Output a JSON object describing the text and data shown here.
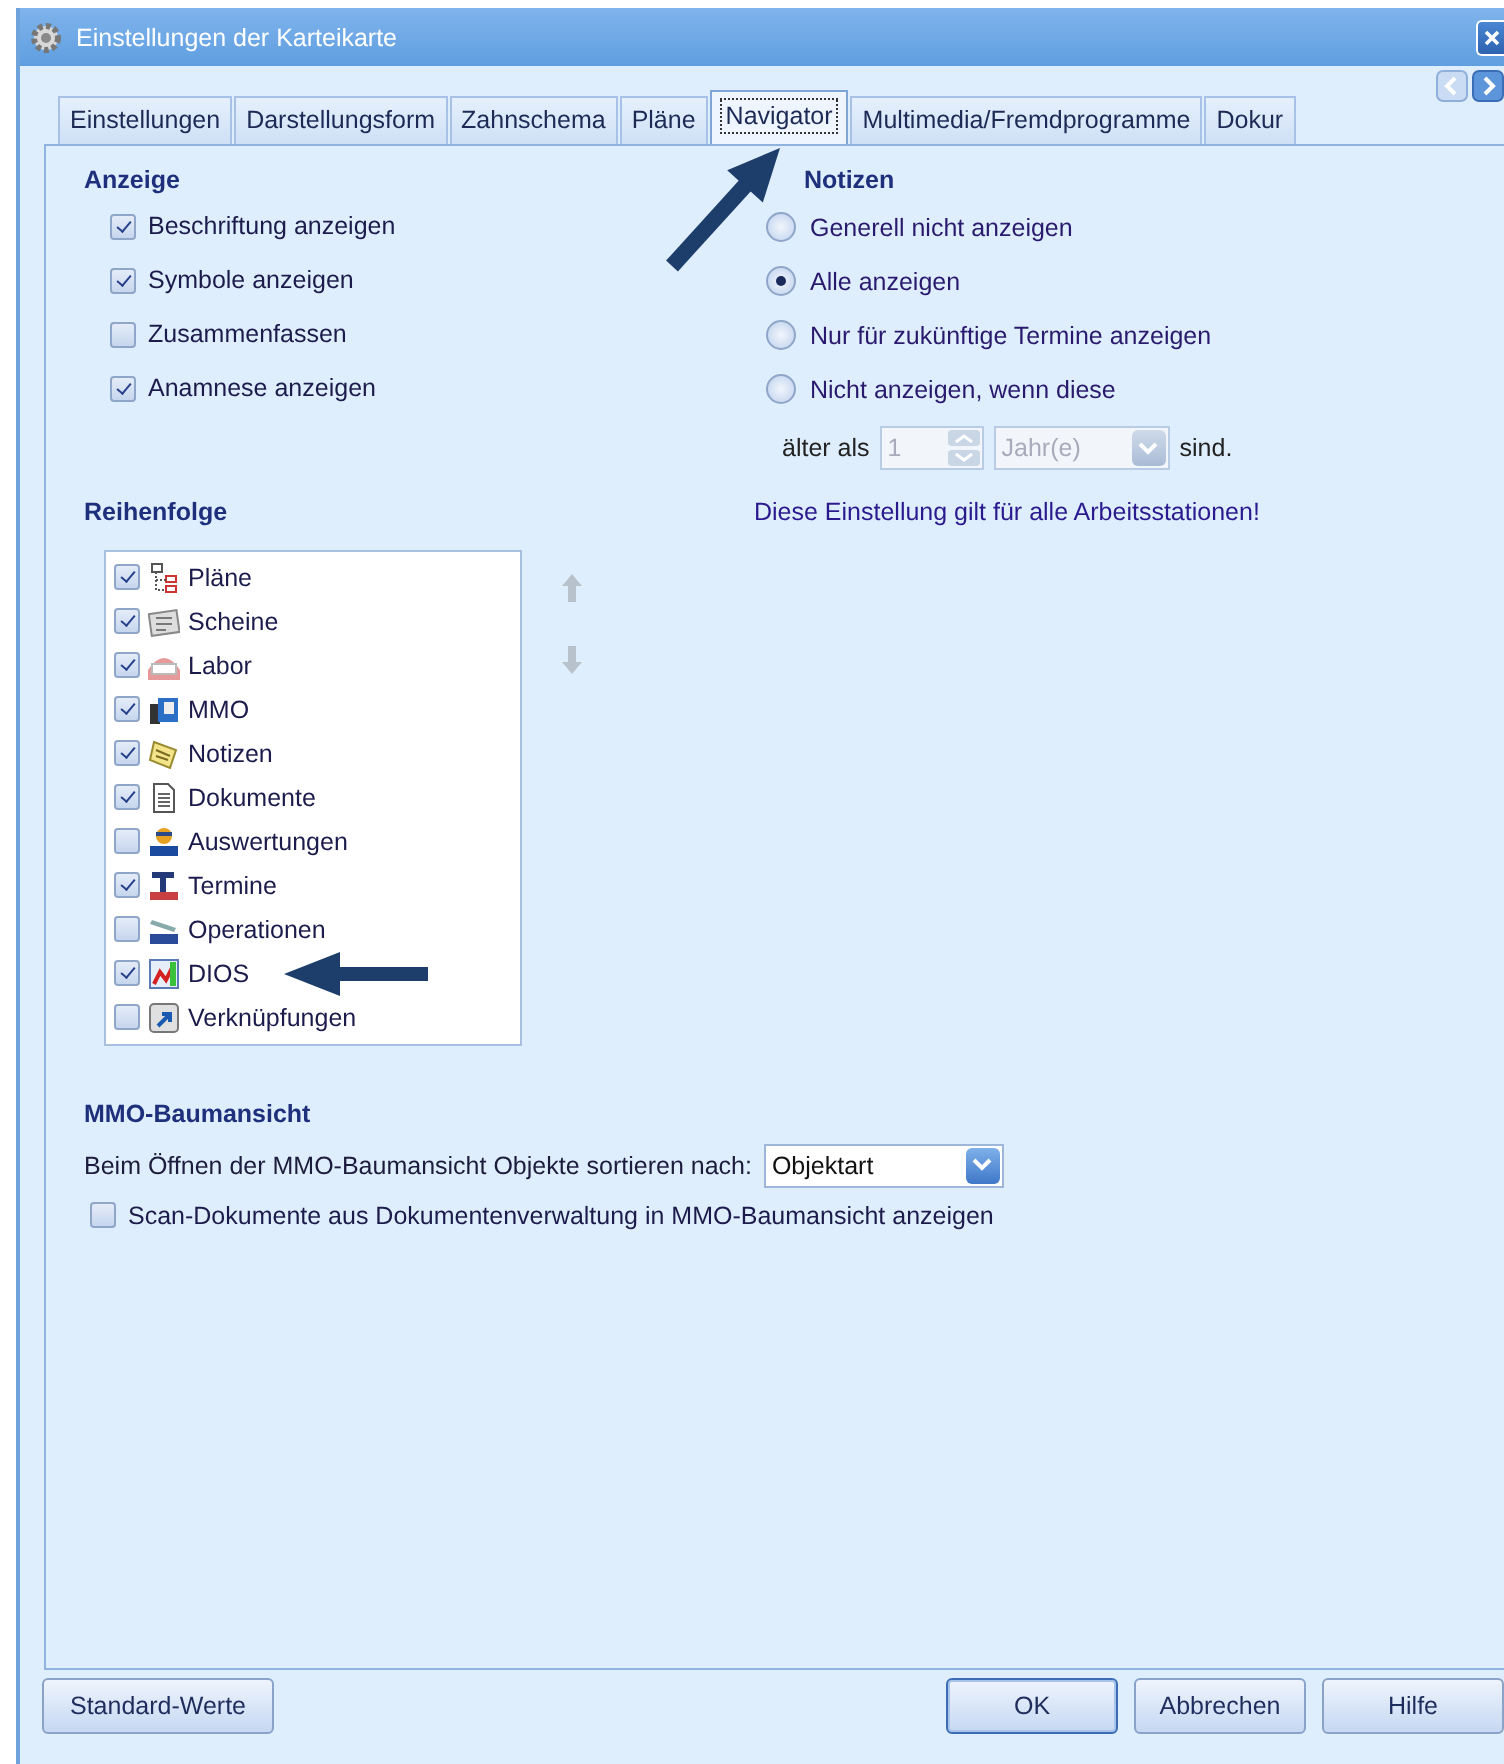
{
  "window": {
    "title": "Einstellungen der Karteikarte"
  },
  "tabs": [
    {
      "label": "Einstellungen",
      "selected": false
    },
    {
      "label": "Darstellungsform",
      "selected": false
    },
    {
      "label": "Zahnschema",
      "selected": false
    },
    {
      "label": "Pläne",
      "selected": false
    },
    {
      "label": "Navigator",
      "selected": true
    },
    {
      "label": "Multimedia/Fremdprogramme",
      "selected": false
    },
    {
      "label": "Dokur",
      "selected": false
    }
  ],
  "anzeige": {
    "heading": "Anzeige",
    "options": [
      {
        "label": "Beschriftung anzeigen",
        "checked": true
      },
      {
        "label": "Symbole anzeigen",
        "checked": true
      },
      {
        "label": "Zusammenfassen",
        "checked": false
      },
      {
        "label": "Anamnese anzeigen",
        "checked": true
      }
    ]
  },
  "notizen": {
    "heading": "Notizen",
    "options": [
      {
        "label": "Generell nicht anzeigen",
        "selected": false
      },
      {
        "label": "Alle anzeigen",
        "selected": true
      },
      {
        "label": "Nur für zukünftige Termine anzeigen",
        "selected": false
      },
      {
        "label": "Nicht anzeigen, wenn diese",
        "selected": false
      }
    ],
    "age_filter": {
      "prefix": "älter als",
      "value": "1",
      "unit": "Jahr(e)",
      "suffix": "sind.",
      "disabled": true
    },
    "note": "Diese Einstellung gilt für alle Arbeitsstationen!"
  },
  "reihenfolge": {
    "heading": "Reihenfolge",
    "items": [
      {
        "label": "Pläne",
        "checked": true
      },
      {
        "label": "Scheine",
        "checked": true
      },
      {
        "label": "Labor",
        "checked": true
      },
      {
        "label": "MMO",
        "checked": true
      },
      {
        "label": "Notizen",
        "checked": true
      },
      {
        "label": "Dokumente",
        "checked": true
      },
      {
        "label": "Auswertungen",
        "checked": false
      },
      {
        "label": "Termine",
        "checked": true
      },
      {
        "label": "Operationen",
        "checked": false
      },
      {
        "label": "DIOS",
        "checked": true
      },
      {
        "label": "Verknüpfungen",
        "checked": false
      }
    ]
  },
  "mmo": {
    "heading": "MMO-Baumansicht",
    "sort_label": "Beim Öffnen der MMO-Baumansicht Objekte sortieren nach:",
    "sort_value": "Objektart",
    "scan_option": {
      "label": "Scan-Dokumente aus Dokumentenverwaltung in MMO-Baumansicht anzeigen",
      "checked": false
    }
  },
  "buttons": [
    {
      "label": "Standard-Werte",
      "default": false
    },
    {
      "label": "OK",
      "default": true
    },
    {
      "label": "Abbrechen",
      "default": false
    },
    {
      "label": "Hilfe",
      "default": false
    }
  ]
}
